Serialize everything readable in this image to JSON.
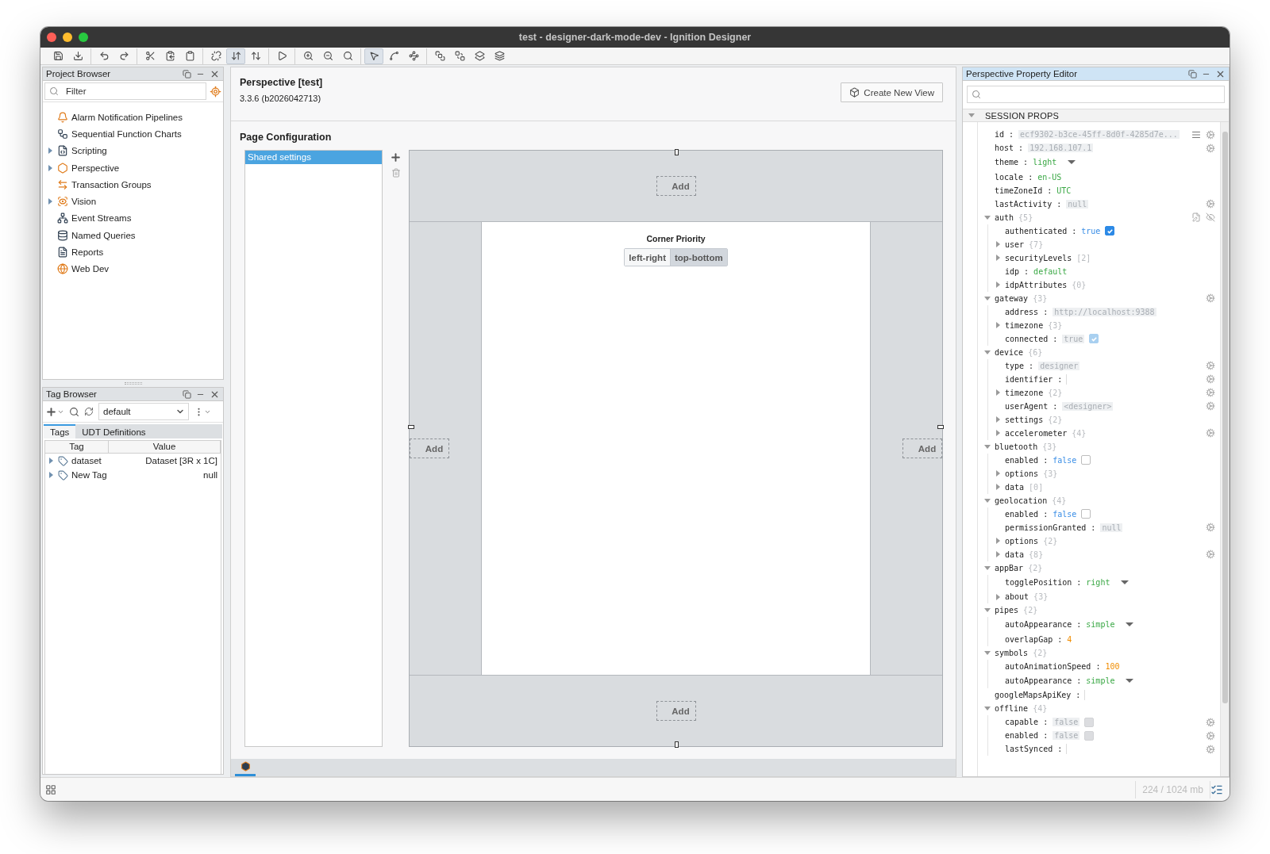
{
  "window": {
    "title": "test - designer-dark-mode-dev - Ignition Designer"
  },
  "toolbar": {
    "groups": [
      [
        {
          "selected": false
        },
        {
          "selected": false
        }
      ],
      [
        {
          "selected": false
        },
        {
          "selected": false
        }
      ],
      [
        {
          "selected": false
        },
        {
          "selected": false
        },
        {
          "selected": false
        }
      ],
      [
        {
          "selected": false
        },
        {
          "selected": true
        },
        {
          "selected": false
        }
      ],
      [
        {
          "selected": false
        }
      ],
      [
        {
          "selected": false
        },
        {
          "selected": false
        },
        {
          "selected": false
        }
      ],
      [
        {
          "selected": true
        },
        {
          "selected": false
        },
        {
          "selected": false
        }
      ],
      [
        {
          "selected": false
        },
        {
          "selected": false
        },
        {
          "selected": false
        },
        {
          "selected": false
        }
      ]
    ]
  },
  "project_browser": {
    "title": "Project Browser",
    "filter": {
      "placeholder": "Filter"
    },
    "items": [
      {
        "label": "Alarm Notification Pipelines"
      },
      {
        "label": "Sequential Function Charts"
      },
      {
        "label": "Scripting",
        "expanded": false
      },
      {
        "label": "Perspective",
        "expanded": false
      },
      {
        "label": "Transaction Groups"
      },
      {
        "label": "Vision",
        "expanded": false
      },
      {
        "label": "Event Streams"
      },
      {
        "label": "Named Queries"
      },
      {
        "label": "Reports"
      },
      {
        "label": "Web Dev"
      }
    ]
  },
  "tag_browser": {
    "title": "Tag Browser",
    "provider": "default",
    "tabs": [
      {
        "label": "Tags",
        "selected": true
      },
      {
        "label": "UDT Definitions",
        "selected": false
      }
    ],
    "columns": [
      "Tag",
      "Value"
    ],
    "rows": [
      {
        "tag": "dataset",
        "value": "Dataset [3R x 1C]",
        "expanded": false
      },
      {
        "tag": "New Tag",
        "value": "null",
        "expanded": false
      }
    ]
  },
  "workspace": {
    "title": "Perspective [test]",
    "version": "3.3.6 (b2026042713)",
    "create_button": "Create New View",
    "section_title": "Page Configuration",
    "pages": [
      {
        "label": "Shared settings",
        "selected": true
      }
    ],
    "layout": {
      "regions": [
        {
          "kind": "top",
          "add": "Add"
        },
        {
          "kind": "left",
          "add": "Add"
        },
        {
          "kind": "right",
          "add": "Add"
        },
        {
          "kind": "bottom",
          "add": "Add"
        }
      ],
      "corner_priority": {
        "label": "Corner Priority",
        "options": [
          {
            "label": "left-right",
            "selected": false
          },
          {
            "label": "top-bottom",
            "selected": true
          }
        ]
      }
    },
    "bottom_tabs": [
      {
        "selected": true
      }
    ]
  },
  "property_editor": {
    "title": "Perspective Property Editor",
    "section": {
      "label": "SESSION PROPS",
      "expanded": true
    },
    "items": [
      {
        "name": "id :",
        "kind": "readonly",
        "value": "ecf9302-b3ce-45ff-8d0f-4285d7e...",
        "icons": [
          {
            "kind": "list"
          },
          {
            "kind": "gear"
          }
        ]
      },
      {
        "name": "host :",
        "kind": "readonly",
        "value": "192.168.107.1",
        "icons": [
          {
            "kind": "gear"
          }
        ]
      },
      {
        "name": "theme :",
        "kind": "string",
        "value": "light",
        "dropdown": true
      },
      {
        "name": "locale :",
        "kind": "string",
        "value": "en-US"
      },
      {
        "name": "timeZoneId :",
        "kind": "string",
        "value": "UTC"
      },
      {
        "name": "lastActivity :",
        "kind": "readonly",
        "value": "null",
        "icons": [
          {
            "kind": "gear"
          }
        ]
      },
      {
        "name": "auth",
        "kind": "object",
        "count": "{5}",
        "expanded": true,
        "icons": [
          {
            "kind": "doc"
          },
          {
            "kind": "eye"
          }
        ],
        "children": [
          {
            "name": "authenticated :",
            "kind": "boolean",
            "value": "true",
            "checked": true
          },
          {
            "name": "user",
            "kind": "object",
            "count": "{7}",
            "expanded": false
          },
          {
            "name": "securityLevels",
            "kind": "object",
            "count": "[2]",
            "expanded": false
          },
          {
            "name": "idp :",
            "kind": "string",
            "value": "default"
          },
          {
            "name": "idpAttributes",
            "kind": "object",
            "count": "{0}",
            "expanded": false
          }
        ]
      },
      {
        "name": "gateway",
        "kind": "object",
        "count": "{3}",
        "expanded": true,
        "icons": [
          {
            "kind": "gear"
          }
        ],
        "children": [
          {
            "name": "address :",
            "kind": "readonly",
            "value": "http://localhost:9388"
          },
          {
            "name": "timezone",
            "kind": "object",
            "count": "{3}",
            "expanded": false
          },
          {
            "name": "connected :",
            "kind": "readonly",
            "value": "true",
            "checked": true
          }
        ]
      },
      {
        "name": "device",
        "kind": "object",
        "count": "{6}",
        "expanded": true,
        "children": [
          {
            "name": "type :",
            "kind": "readonly",
            "value": "designer",
            "icons": [
              {
                "kind": "gear"
              }
            ]
          },
          {
            "name": "identifier :",
            "kind": "empty",
            "icons": [
              {
                "kind": "gear"
              }
            ]
          },
          {
            "name": "timezone",
            "kind": "object",
            "count": "{2}",
            "expanded": false,
            "icons": [
              {
                "kind": "gear"
              }
            ]
          },
          {
            "name": "userAgent :",
            "kind": "readonly",
            "value": "<designer>",
            "icons": [
              {
                "kind": "gear"
              }
            ]
          },
          {
            "name": "settings",
            "kind": "object",
            "count": "{2}",
            "expanded": false
          },
          {
            "name": "accelerometer",
            "kind": "object",
            "count": "{4}",
            "expanded": false,
            "icons": [
              {
                "kind": "gear"
              }
            ]
          }
        ]
      },
      {
        "name": "bluetooth",
        "kind": "object",
        "count": "{3}",
        "expanded": true,
        "children": [
          {
            "name": "enabled :",
            "kind": "boolean",
            "value": "false",
            "checked": false
          },
          {
            "name": "options",
            "kind": "object",
            "count": "{3}",
            "expanded": false
          },
          {
            "name": "data",
            "kind": "object",
            "count": "[0]",
            "expanded": false
          }
        ]
      },
      {
        "name": "geolocation",
        "kind": "object",
        "count": "{4}",
        "expanded": true,
        "children": [
          {
            "name": "enabled :",
            "kind": "boolean",
            "value": "false",
            "checked": false
          },
          {
            "name": "permissionGranted :",
            "kind": "readonly",
            "value": "null",
            "icons": [
              {
                "kind": "gear"
              }
            ]
          },
          {
            "name": "options",
            "kind": "object",
            "count": "{2}",
            "expanded": false
          },
          {
            "name": "data",
            "kind": "object",
            "count": "{8}",
            "expanded": false,
            "icons": [
              {
                "kind": "gear"
              }
            ]
          }
        ]
      },
      {
        "name": "appBar",
        "kind": "object",
        "count": "{2}",
        "expanded": true,
        "children": [
          {
            "name": "togglePosition :",
            "kind": "string",
            "value": "right",
            "dropdown": true
          },
          {
            "name": "about",
            "kind": "object",
            "count": "{3}",
            "expanded": false
          }
        ]
      },
      {
        "name": "pipes",
        "kind": "object",
        "count": "{2}",
        "expanded": true,
        "children": [
          {
            "name": "autoAppearance :",
            "kind": "string",
            "value": "simple",
            "dropdown": true
          },
          {
            "name": "overlapGap :",
            "kind": "number",
            "value": "4"
          }
        ]
      },
      {
        "name": "symbols",
        "kind": "object",
        "count": "{2}",
        "expanded": true,
        "children": [
          {
            "name": "autoAnimationSpeed :",
            "kind": "number",
            "value": "100"
          },
          {
            "name": "autoAppearance :",
            "kind": "string",
            "value": "simple",
            "dropdown": true
          }
        ]
      },
      {
        "name": "googleMapsApiKey :",
        "kind": "empty"
      },
      {
        "name": "offline",
        "kind": "object",
        "count": "{4}",
        "expanded": true,
        "children": [
          {
            "name": "capable :",
            "kind": "readonly",
            "value": "false",
            "checked": false,
            "icons": [
              {
                "kind": "gear"
              }
            ]
          },
          {
            "name": "enabled :",
            "kind": "readonly",
            "value": "false",
            "checked": false,
            "icons": [
              {
                "kind": "gear"
              }
            ]
          },
          {
            "name": "lastSynced :",
            "kind": "empty",
            "icons": [
              {
                "kind": "gear"
              }
            ]
          }
        ]
      }
    ]
  },
  "status_bar": {
    "memory": "224 / 1024 mb"
  }
}
